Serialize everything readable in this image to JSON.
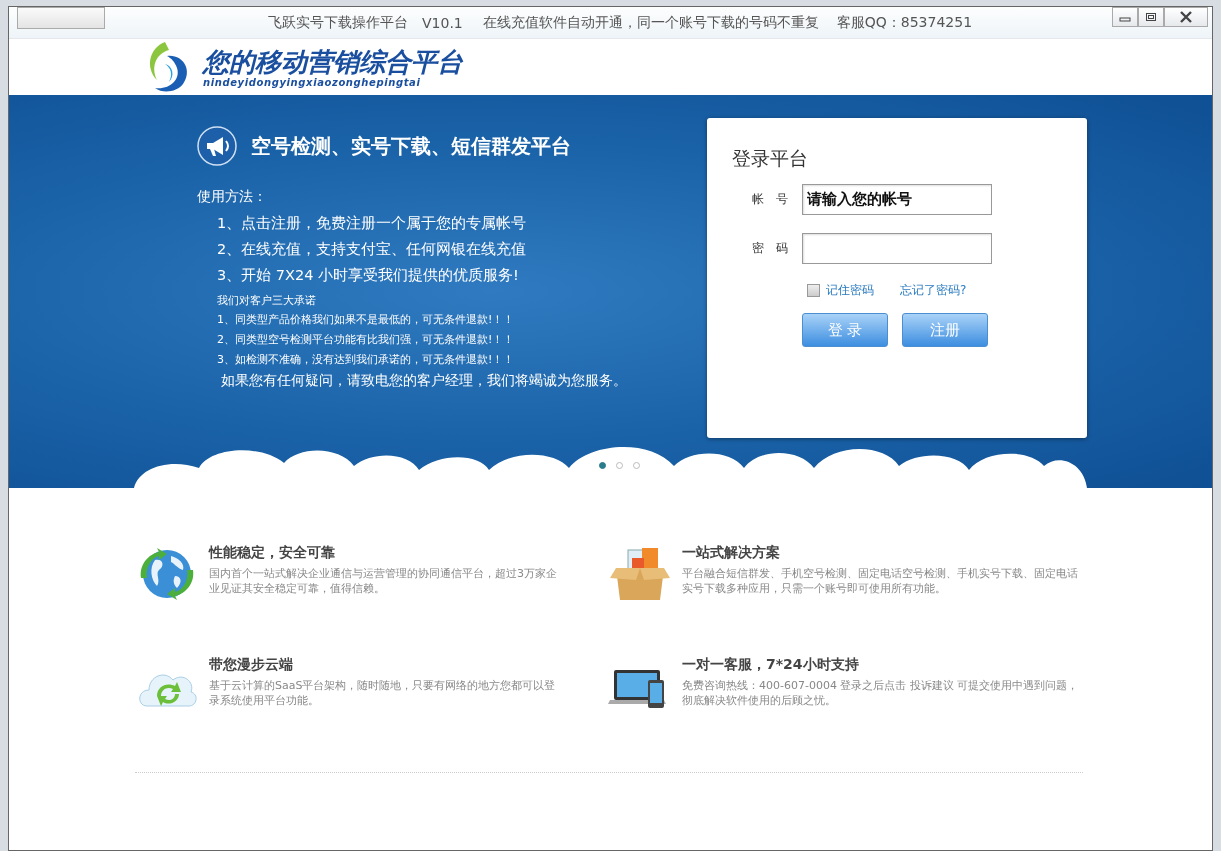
{
  "window": {
    "title": "飞跃实号下载操作平台",
    "version": "V10.1",
    "notice": "在线充值软件自动开通，同一个账号下载的号码不重复",
    "support": "客服QQ：85374251"
  },
  "logo": {
    "title": "您的移动营销综合平台",
    "pinyin": "nindeyidongyingxiaozonghepingtai"
  },
  "banner": {
    "headline": "空号检测、实号下载、短信群发平台",
    "usage_title": "使用方法：",
    "steps": [
      "1、点击注册，免费注册一个属于您的专属帐号",
      "2、在线充值，支持支付宝、任何网银在线充值",
      "3、开始 7X24 小时享受我们提供的优质服务!"
    ],
    "promise_title": "我们对客户三大承诺",
    "promises": [
      "1、同类型产品价格我们如果不是最低的，可无条件退款!！！",
      "2、同类型空号检测平台功能有比我们强，可无条件退款!！！",
      "3、如检测不准确，没有达到我们承诺的，可无条件退款!！！"
    ],
    "closing": "如果您有任何疑问，请致电您的客户经理，我们将竭诚为您服务。"
  },
  "carousel": [
    {
      "selected": true
    },
    {
      "selected": false
    },
    {
      "selected": false
    }
  ],
  "login": {
    "title": "登录平台",
    "fields": [
      {
        "label": "帐　号",
        "kind": "text",
        "value": "请输入您的帐号"
      },
      {
        "label": "密　码",
        "kind": "password"
      }
    ],
    "remember": {
      "label": "记住密码",
      "checked": false
    },
    "forgot": "忘记了密码?",
    "buttons": [
      "登 录",
      "注册"
    ]
  },
  "features": [
    {
      "kind": "globe",
      "title": "性能稳定，安全可靠",
      "description": "国内首个一站式解决企业通信与运营管理的协同通信平台，超过3万家企业见证其安全稳定可靠，值得信赖。"
    },
    {
      "kind": "box",
      "title": "一站式解决方案",
      "description": "平台融合短信群发、手机空号检测、固定电话空号检测、手机实号下载、固定电话实号下载多种应用，只需一个账号即可使用所有功能。"
    },
    {
      "kind": "cloud",
      "title": "带您漫步云端",
      "description": "基于云计算的SaaS平台架构，随时随地，只要有网络的地方您都可以登录系统使用平台功能。"
    },
    {
      "kind": "devices",
      "title": "一对一客服，7*24小时支持",
      "description": "免费咨询热线：400-607-0004 登录之后点击 投诉建议 可提交使用中遇到问题，彻底解决软件使用的后顾之忧。"
    }
  ]
}
